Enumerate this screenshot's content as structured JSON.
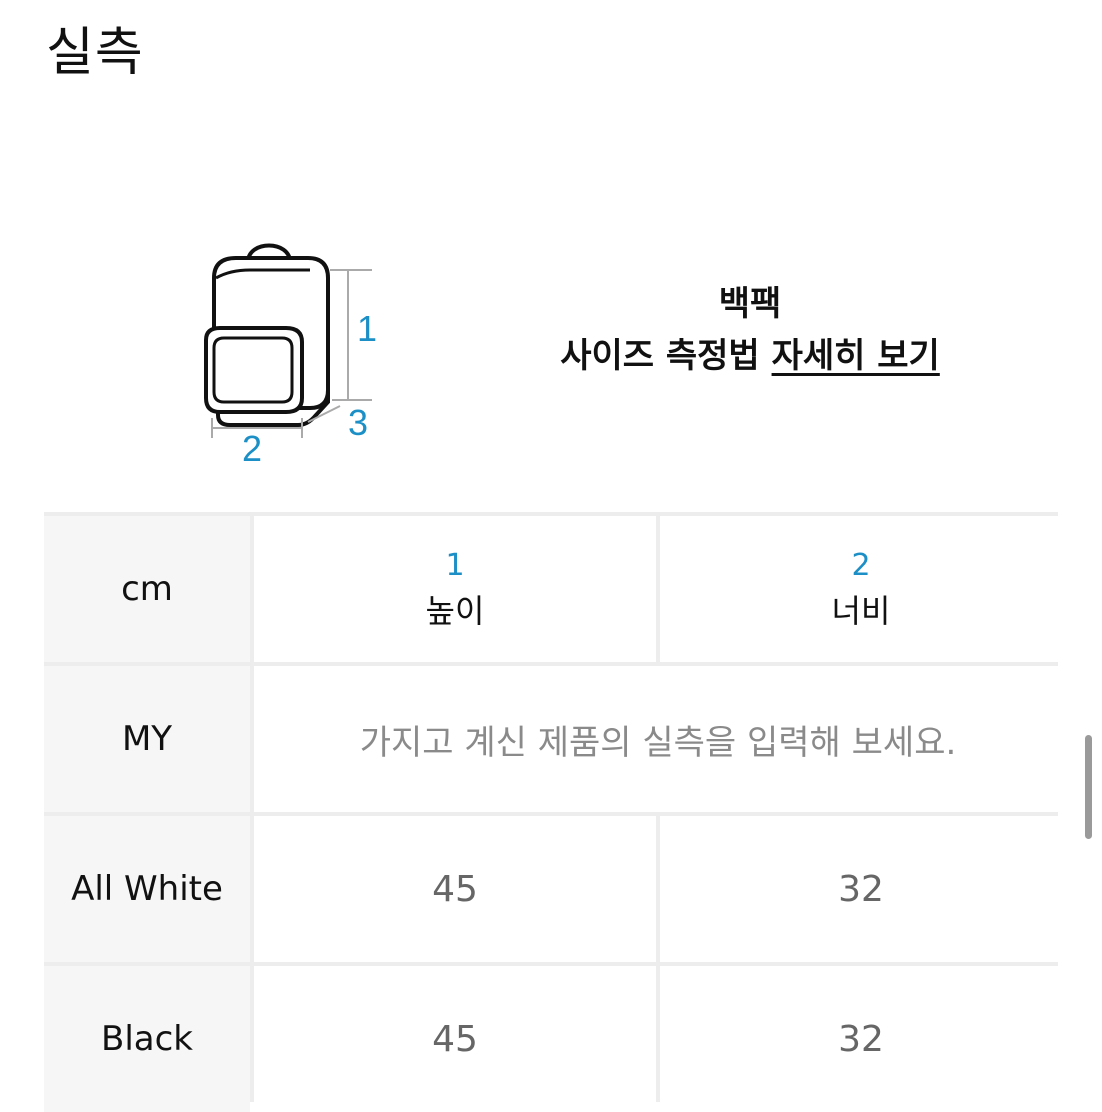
{
  "title": "실측",
  "diagram": {
    "icon": "backpack-icon",
    "dimension_labels": [
      "1",
      "2",
      "3"
    ],
    "accent_color": "#1b8fc6"
  },
  "info": {
    "category": "백팩",
    "method_prefix": "사이즈 측정법",
    "method_link": "자세히 보기"
  },
  "table": {
    "unit_header": "cm",
    "columns": [
      {
        "number": "1",
        "label": "높이"
      },
      {
        "number": "2",
        "label": "너비"
      }
    ],
    "my_row": {
      "label": "MY",
      "message": "가지고 계신 제품의 실측을 입력해 보세요."
    },
    "rows": [
      {
        "label": "All White",
        "values": [
          "45",
          "32"
        ]
      },
      {
        "label": "Black",
        "values": [
          "45",
          "32"
        ]
      }
    ]
  }
}
